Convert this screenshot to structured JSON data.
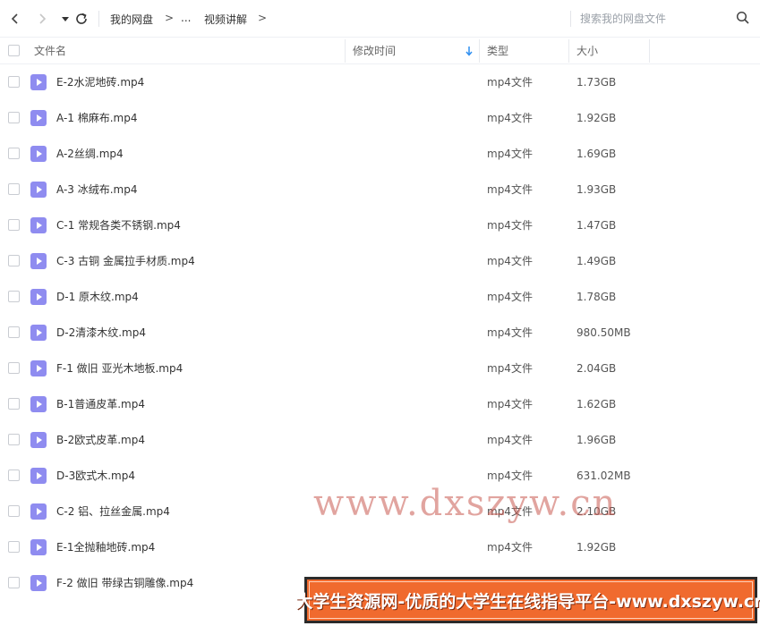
{
  "nav": {
    "breadcrumb": [
      "我的网盘",
      "...",
      "视频讲解"
    ],
    "separator": ">",
    "search_placeholder": "搜索我的网盘文件"
  },
  "columns": {
    "name": "文件名",
    "modified": "修改时间",
    "type": "类型",
    "size": "大小"
  },
  "files": [
    {
      "name": "E-2水泥地砖.mp4",
      "type": "mp4文件",
      "size": "1.73GB"
    },
    {
      "name": "A-1 棉麻布.mp4",
      "type": "mp4文件",
      "size": "1.92GB"
    },
    {
      "name": "A-2丝绸.mp4",
      "type": "mp4文件",
      "size": "1.69GB"
    },
    {
      "name": "A-3 冰绒布.mp4",
      "type": "mp4文件",
      "size": "1.93GB"
    },
    {
      "name": "C-1 常规各类不锈钢.mp4",
      "type": "mp4文件",
      "size": "1.47GB"
    },
    {
      "name": "C-3 古铜 金属拉手材质.mp4",
      "type": "mp4文件",
      "size": "1.49GB"
    },
    {
      "name": "D-1 原木纹.mp4",
      "type": "mp4文件",
      "size": "1.78GB"
    },
    {
      "name": "D-2清漆木纹.mp4",
      "type": "mp4文件",
      "size": "980.50MB"
    },
    {
      "name": "F-1 做旧 亚光木地板.mp4",
      "type": "mp4文件",
      "size": "2.04GB"
    },
    {
      "name": "B-1普通皮革.mp4",
      "type": "mp4文件",
      "size": "1.62GB"
    },
    {
      "name": "B-2欧式皮革.mp4",
      "type": "mp4文件",
      "size": "1.96GB"
    },
    {
      "name": "D-3欧式木.mp4",
      "type": "mp4文件",
      "size": "631.02MB"
    },
    {
      "name": "C-2 铝、拉丝金属.mp4",
      "type": "mp4文件",
      "size": "2.10GB"
    },
    {
      "name": "E-1全抛釉地砖.mp4",
      "type": "mp4文件",
      "size": "1.92GB"
    },
    {
      "name": "F-2 做旧 带绿古铜雕像.mp4",
      "type": "",
      "size": ""
    }
  ],
  "watermark": "www.dxszyw.cn",
  "banner": "大学生资源网-优质的大学生在线指导平台-www.dxszyw.cn",
  "colors": {
    "file_icon": "#8f8cf0",
    "sort_arrow": "#2e8ff0",
    "banner_bg": "#f06a2e"
  }
}
